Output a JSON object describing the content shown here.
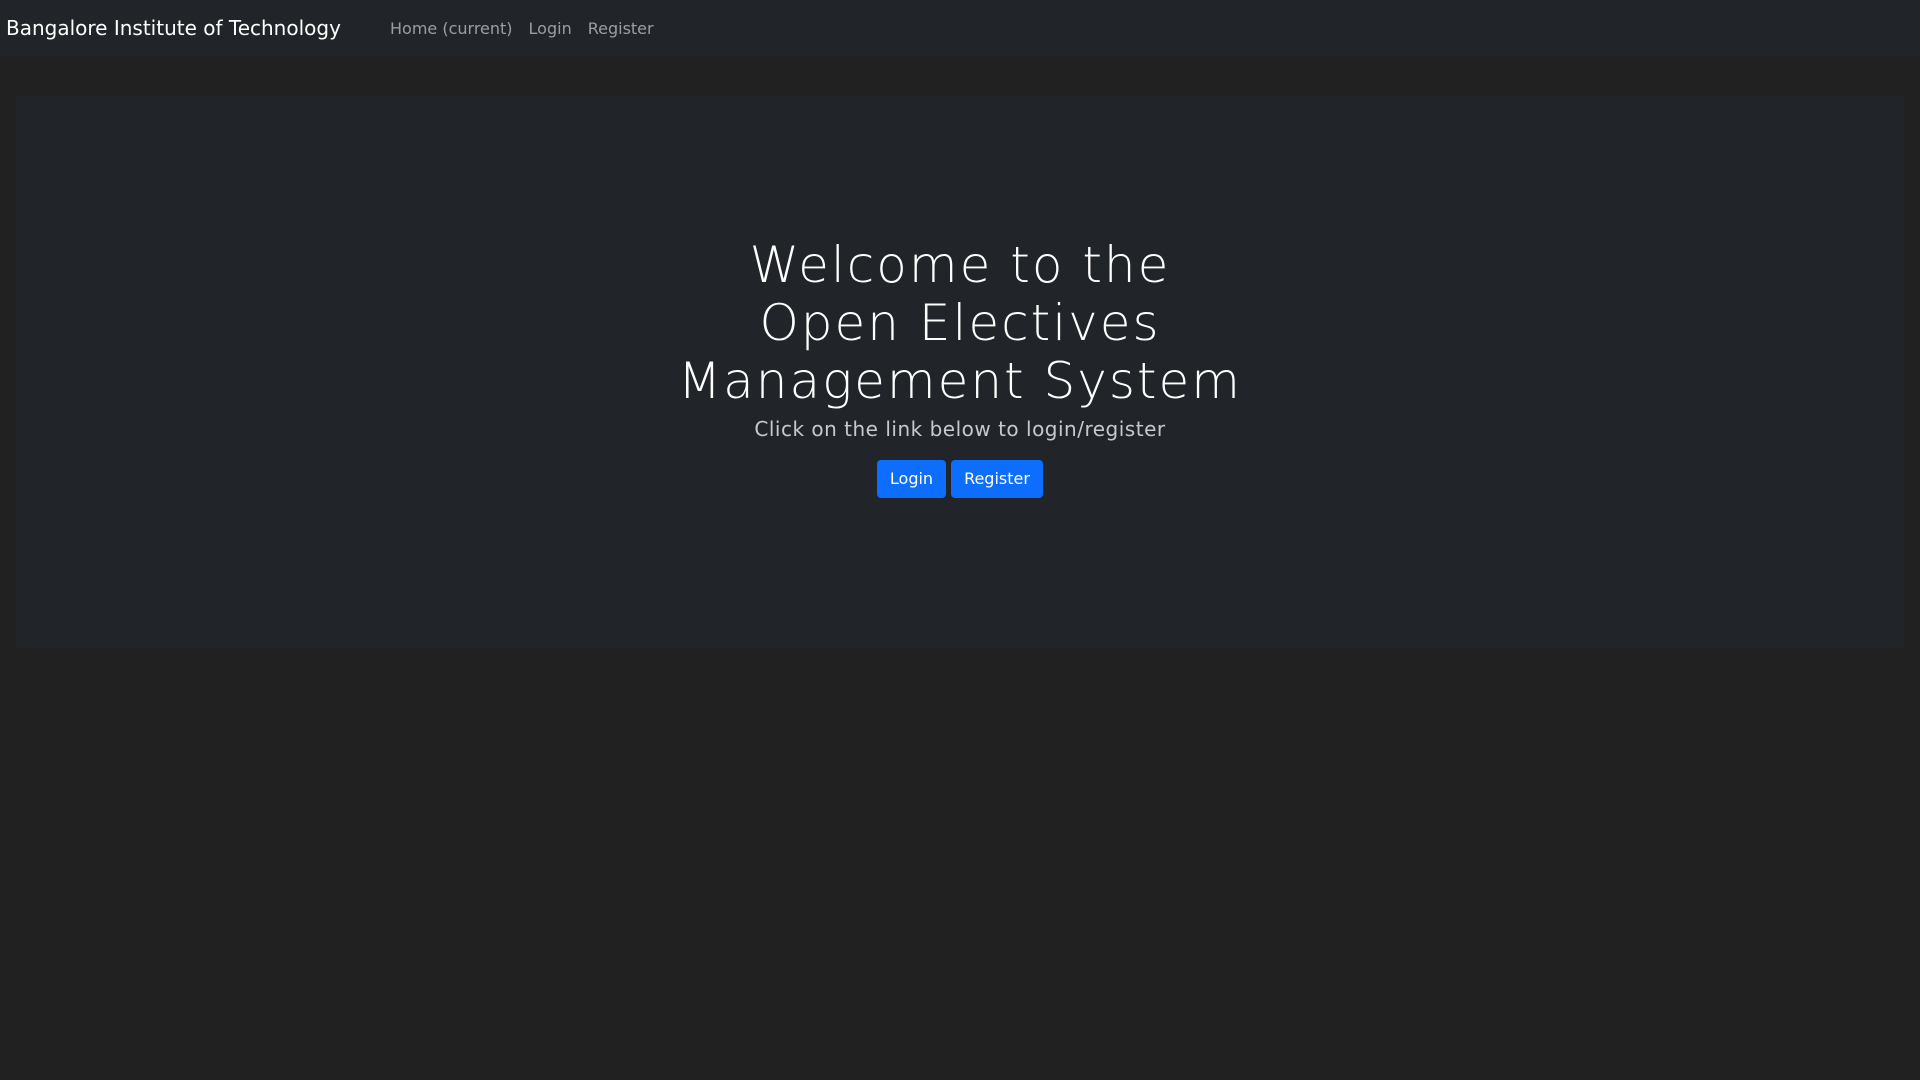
{
  "navbar": {
    "brand": "Bangalore Institute of Technology",
    "links": [
      {
        "label": "Home (current)"
      },
      {
        "label": "Login"
      },
      {
        "label": "Register"
      }
    ]
  },
  "hero": {
    "title_line1": "Welcome to the",
    "title_line2": "Open Electives",
    "title_line3": "Management System",
    "subtitle": "Click on the link below to login/register",
    "login_button": "Login",
    "register_button": "Register"
  },
  "colors": {
    "background": "#212121",
    "panel": "#212529",
    "primary": "#0d6efd"
  }
}
